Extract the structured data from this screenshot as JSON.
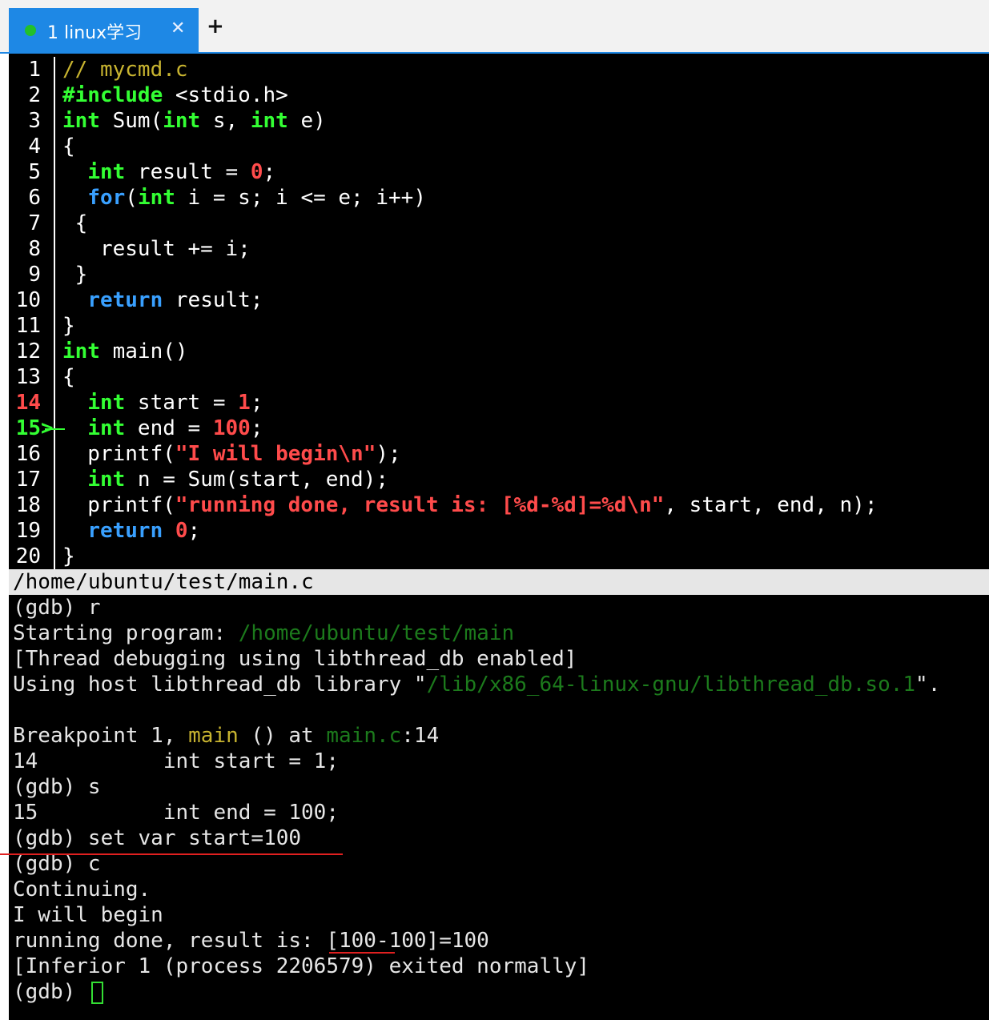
{
  "tab": {
    "label": "1 linux学习",
    "close": "✕",
    "new_tab": "+"
  },
  "colors": {
    "tab_active": "#1e88e5",
    "status_dot": "#22c02a",
    "terminal_bg": "#000000",
    "keyword": "#33ff33",
    "flow_keyword": "#39a0ff",
    "literal": "#ff4b4b",
    "comment": "#c8b430",
    "path": "#1c7a1c",
    "annotation": "#e02020"
  },
  "code": {
    "lines": [
      {
        "n": "1",
        "tokens": [
          {
            "t": "// mycmd.c",
            "c": "cmt"
          }
        ]
      },
      {
        "n": "2",
        "tokens": [
          {
            "t": "#include",
            "c": "kw"
          },
          {
            "t": " <stdio.h>"
          }
        ]
      },
      {
        "n": "3",
        "tokens": [
          {
            "t": "int",
            "c": "kw"
          },
          {
            "t": " Sum("
          },
          {
            "t": "int",
            "c": "kw"
          },
          {
            "t": " s, "
          },
          {
            "t": "int",
            "c": "kw"
          },
          {
            "t": " e)"
          }
        ]
      },
      {
        "n": "4",
        "tokens": [
          {
            "t": "{"
          }
        ]
      },
      {
        "n": "5",
        "tokens": [
          {
            "t": "  "
          },
          {
            "t": "int",
            "c": "kw"
          },
          {
            "t": " result = "
          },
          {
            "t": "0",
            "c": "num"
          },
          {
            "t": ";"
          }
        ]
      },
      {
        "n": "6",
        "tokens": [
          {
            "t": "  "
          },
          {
            "t": "for",
            "c": "kb"
          },
          {
            "t": "("
          },
          {
            "t": "int",
            "c": "kw"
          },
          {
            "t": " i = s; i <= e; i++)"
          }
        ]
      },
      {
        "n": "7",
        "tokens": [
          {
            "t": " {"
          }
        ]
      },
      {
        "n": "8",
        "tokens": [
          {
            "t": "   result += i;"
          }
        ]
      },
      {
        "n": "9",
        "tokens": [
          {
            "t": " }"
          }
        ]
      },
      {
        "n": "10",
        "tokens": [
          {
            "t": "  "
          },
          {
            "t": "return",
            "c": "kb"
          },
          {
            "t": " result;"
          }
        ]
      },
      {
        "n": "11",
        "tokens": [
          {
            "t": "}"
          }
        ]
      },
      {
        "n": "12",
        "tokens": [
          {
            "t": "int",
            "c": "kw"
          },
          {
            "t": " main()"
          }
        ]
      },
      {
        "n": "13",
        "tokens": [
          {
            "t": "{"
          }
        ]
      },
      {
        "n": "14",
        "state": "bp",
        "tokens": [
          {
            "t": "  "
          },
          {
            "t": "int",
            "c": "kw"
          },
          {
            "t": " start = "
          },
          {
            "t": "1",
            "c": "num"
          },
          {
            "t": ";"
          }
        ]
      },
      {
        "n": "15",
        "state": "cur",
        "marker": ">",
        "tokens": [
          {
            "t": "  "
          },
          {
            "t": "int",
            "c": "kw"
          },
          {
            "t": " end = "
          },
          {
            "t": "100",
            "c": "num"
          },
          {
            "t": ";"
          }
        ]
      },
      {
        "n": "16",
        "tokens": [
          {
            "t": "  printf("
          },
          {
            "t": "\"I will begin\\n\"",
            "c": "str"
          },
          {
            "t": ");"
          }
        ]
      },
      {
        "n": "17",
        "tokens": [
          {
            "t": "  "
          },
          {
            "t": "int",
            "c": "kw"
          },
          {
            "t": " n = Sum(start, end);"
          }
        ]
      },
      {
        "n": "18",
        "tokens": [
          {
            "t": "  printf("
          },
          {
            "t": "\"running done, result is: [%d-%d]=%d\\n\"",
            "c": "str"
          },
          {
            "t": ", start, end, n);"
          }
        ]
      },
      {
        "n": "19",
        "tokens": [
          {
            "t": "  "
          },
          {
            "t": "return",
            "c": "kb"
          },
          {
            "t": " "
          },
          {
            "t": "0",
            "c": "num"
          },
          {
            "t": ";"
          }
        ]
      },
      {
        "n": "20",
        "tokens": [
          {
            "t": "}"
          }
        ]
      }
    ]
  },
  "status_bar": {
    "file_path": "/home/ubuntu/test/main.c"
  },
  "gdb": {
    "lines": [
      [
        {
          "t": "(gdb) r"
        }
      ],
      [
        {
          "t": "Starting program: "
        },
        {
          "t": "/home/ubuntu/test/main",
          "c": "path"
        }
      ],
      [
        {
          "t": "[Thread debugging using libthread_db enabled]"
        }
      ],
      [
        {
          "t": "Using host libthread_db library \""
        },
        {
          "t": "/lib/x86_64-linux-gnu/libthread_db.so.1",
          "c": "path"
        },
        {
          "t": "\"."
        }
      ],
      [
        {
          "t": ""
        }
      ],
      [
        {
          "t": "Breakpoint 1, "
        },
        {
          "t": "main",
          "c": "fn"
        },
        {
          "t": " () at "
        },
        {
          "t": "main.c",
          "c": "path"
        },
        {
          "t": ":14"
        }
      ],
      [
        {
          "t": "14          int start = 1;"
        }
      ],
      [
        {
          "t": "(gdb) s"
        }
      ],
      [
        {
          "t": "15          int end = 100;"
        }
      ],
      [
        {
          "t": "(gdb) set var start=100"
        }
      ],
      [
        {
          "t": "(gdb) c"
        }
      ],
      [
        {
          "t": "Continuing."
        }
      ],
      [
        {
          "t": "I will begin"
        }
      ],
      [
        {
          "t": "running done, result is: [100-100]=100"
        }
      ],
      [
        {
          "t": "[Inferior 1 (process 2206579) exited normally]"
        }
      ],
      [
        {
          "t": "(gdb) "
        }
      ]
    ]
  }
}
